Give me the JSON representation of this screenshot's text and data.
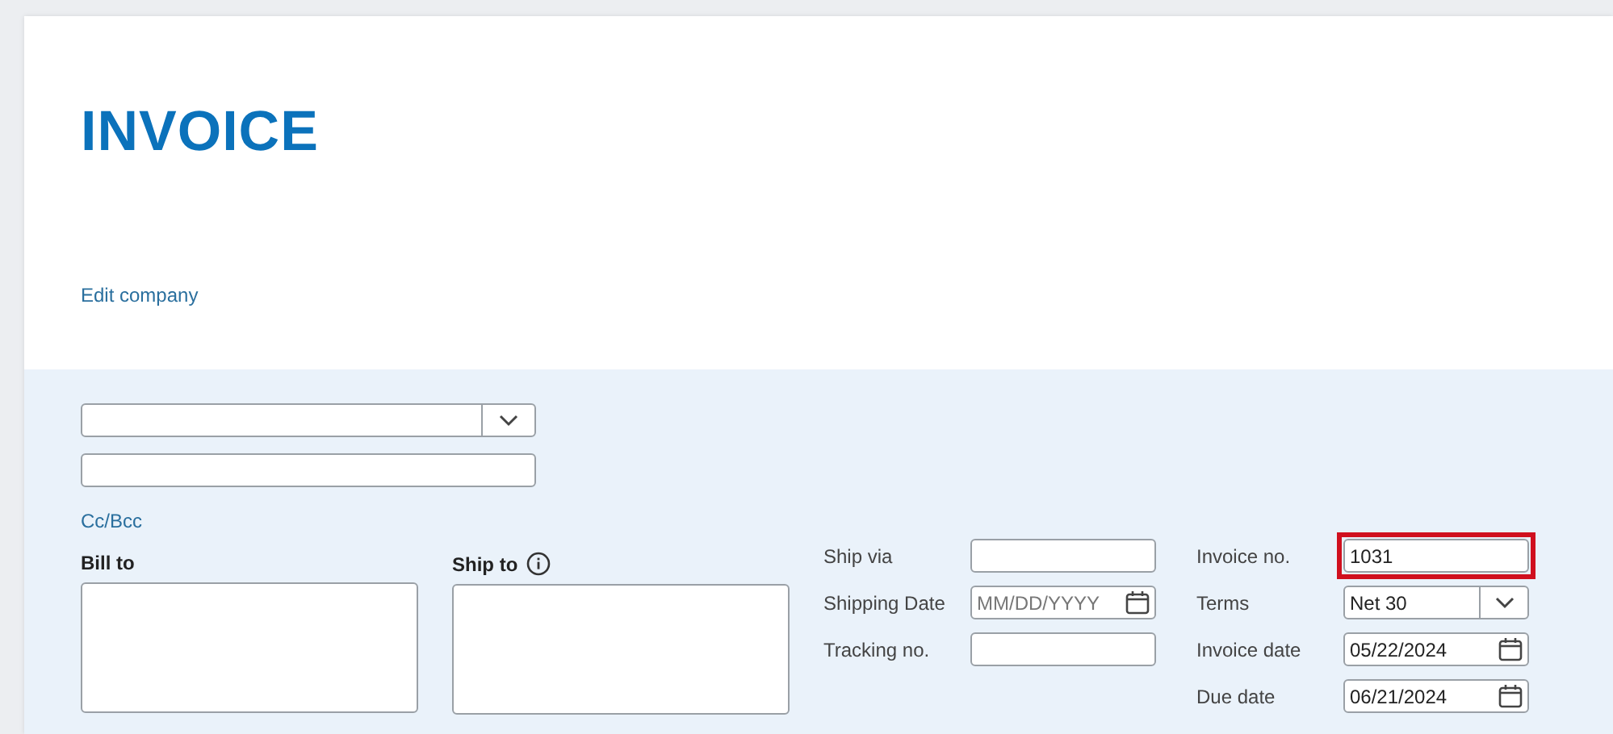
{
  "title": "INVOICE",
  "edit_company": "Edit company",
  "cc_bcc": "Cc/Bcc",
  "bill_to": {
    "label": "Bill to"
  },
  "ship_to": {
    "label": "Ship to"
  },
  "shipping_fields": [
    {
      "label": "Ship via",
      "kind": "text"
    },
    {
      "label": "Shipping Date",
      "kind": "date",
      "placeholder": "MM/DD/YYYY"
    },
    {
      "label": "Tracking no.",
      "kind": "text"
    }
  ],
  "invoice_fields": [
    {
      "label": "Invoice no.",
      "kind": "text",
      "value": "1031",
      "highlighted": true
    },
    {
      "label": "Terms",
      "kind": "select",
      "value": "Net 30"
    },
    {
      "label": "Invoice date",
      "kind": "date",
      "value": "05/22/2024"
    },
    {
      "label": "Due date",
      "kind": "date",
      "value": "06/21/2024"
    }
  ]
}
